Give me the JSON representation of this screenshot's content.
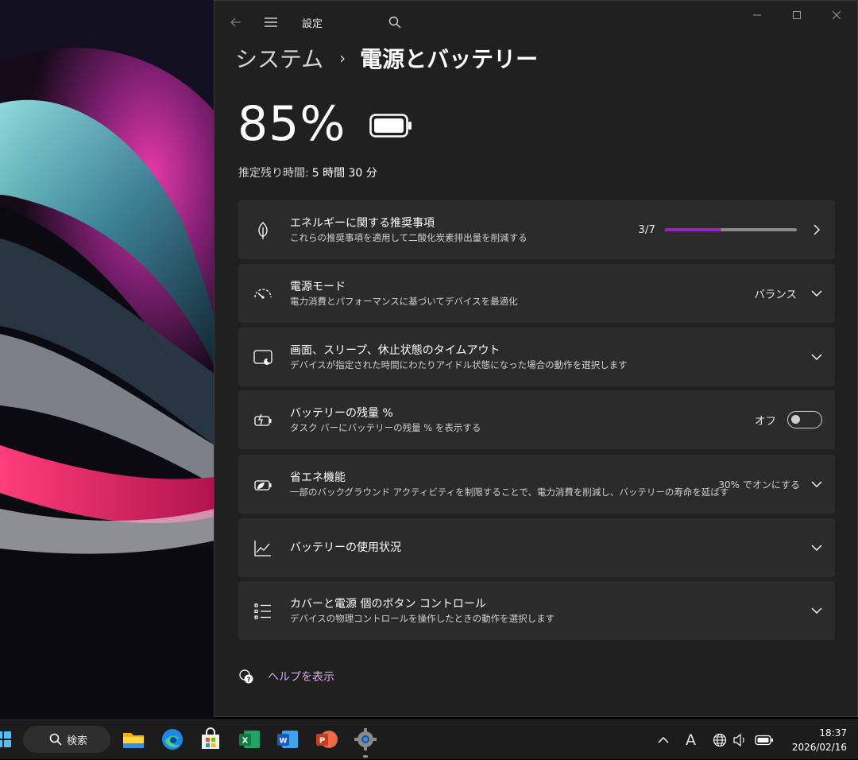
{
  "window": {
    "app_title": "設定",
    "breadcrumb_parent": "システム",
    "breadcrumb_separator": "›",
    "breadcrumb_current": "電源とバッテリー"
  },
  "battery": {
    "percent_text": "85%",
    "level": 0.85,
    "remaining_label": "推定残り時間:",
    "remaining_value": "5 時間 30 分"
  },
  "cards": {
    "energy": {
      "title": "エネルギーに関する推奨事項",
      "subtitle": "これらの推奨事項を適用して二酸化炭素排出量を削減する",
      "progress_text": "3/7",
      "progress_value": 3,
      "progress_total": 7
    },
    "power_mode": {
      "title": "電源モード",
      "subtitle": "電力消費とパフォーマンスに基づいてデバイスを最適化",
      "value": "バランス"
    },
    "timeout": {
      "title": "画面、スリープ、休止状態のタイムアウト",
      "subtitle": "デバイスが指定された時間にわたりアイドル状態になった場合の動作を選択します"
    },
    "battery_percent": {
      "title": "バッテリーの残量 %",
      "subtitle": "タスク バーにバッテリーの残量 % を表示する",
      "toggle_label": "オフ",
      "toggle_on": false
    },
    "energy_saver": {
      "title": "省エネ機能",
      "subtitle": "一部のバックグラウンド アクティビティを制限することで、電力消費を削減し、バッテリーの寿命を延ばす",
      "value": "30% でオンにする"
    },
    "usage": {
      "title": "バッテリーの使用状況"
    },
    "lid": {
      "title": "カバーと電源 個のボタン コントロール",
      "subtitle": "デバイスの物理コントロールを操作したときの動作を選択します"
    }
  },
  "help": {
    "label": "ヘルプを表示"
  },
  "taskbar": {
    "search_label": "検索",
    "time": "18:37",
    "date": "2026/02/16",
    "ime_indicator": "A"
  },
  "colors": {
    "accent": "#9b23c8",
    "window_bg": "#202020",
    "card_bg": "#2b2b2b",
    "link": "#d9a7f0"
  },
  "icons": {
    "back": "arrow-left-icon",
    "menu": "hamburger-icon",
    "search": "search-icon",
    "energy": "leaf-icon",
    "power_mode": "gauge-icon",
    "timeout": "screen-moon-icon",
    "battery_percent": "battery-charge-icon",
    "energy_saver": "battery-leaf-icon",
    "usage": "line-chart-icon",
    "lid": "list-icon",
    "help": "help-chat-icon"
  }
}
